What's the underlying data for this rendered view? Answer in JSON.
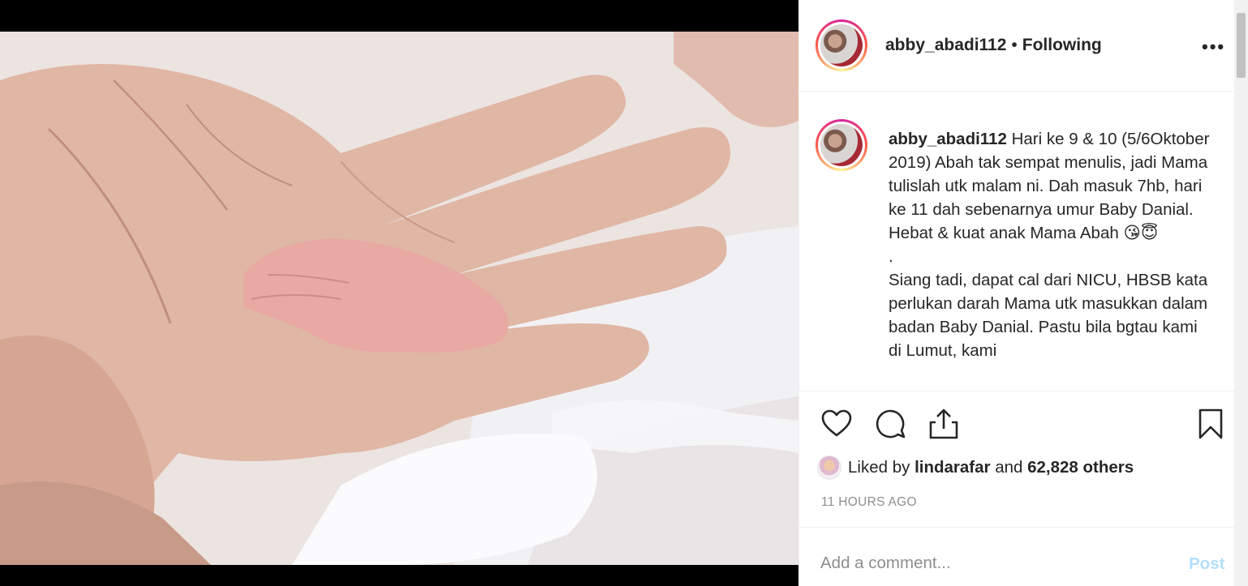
{
  "post": {
    "username": "abby_abadi112",
    "separator": "•",
    "follow_status": "Following",
    "more_icon": "•••"
  },
  "caption": {
    "username": "abby_abadi112",
    "paragraph1": "Hari ke 9 & 10 (5/6Oktober 2019) Abah tak sempat menulis, jadi Mama tulislah utk malam ni. Dah masuk 7hb, hari ke 11 dah sebenarnya umur Baby Danial. Hebat & kuat anak Mama Abah",
    "emoji": "😘😇",
    "paragraph2": ".",
    "paragraph3": "Siang tadi, dapat cal dari NICU, HBSB kata perlukan darah Mama utk masukkan dalam badan Baby Danial. Pastu bila bgtau kami di Lumut, kami"
  },
  "actions": {
    "like_icon": "heart-icon",
    "comment_icon": "comment-icon",
    "share_icon": "share-icon",
    "save_icon": "bookmark-icon"
  },
  "likes": {
    "prefix": "Liked by",
    "liker": "lindarafar",
    "conjunction": "and",
    "count": "62,828 others"
  },
  "timestamp": "11 HOURS AGO",
  "comment": {
    "placeholder": "Add a comment...",
    "post_label": "Post"
  },
  "colors": {
    "post_button_disabled": "#b2dffc",
    "muted_text": "#8e8e8e",
    "text": "#262626"
  }
}
